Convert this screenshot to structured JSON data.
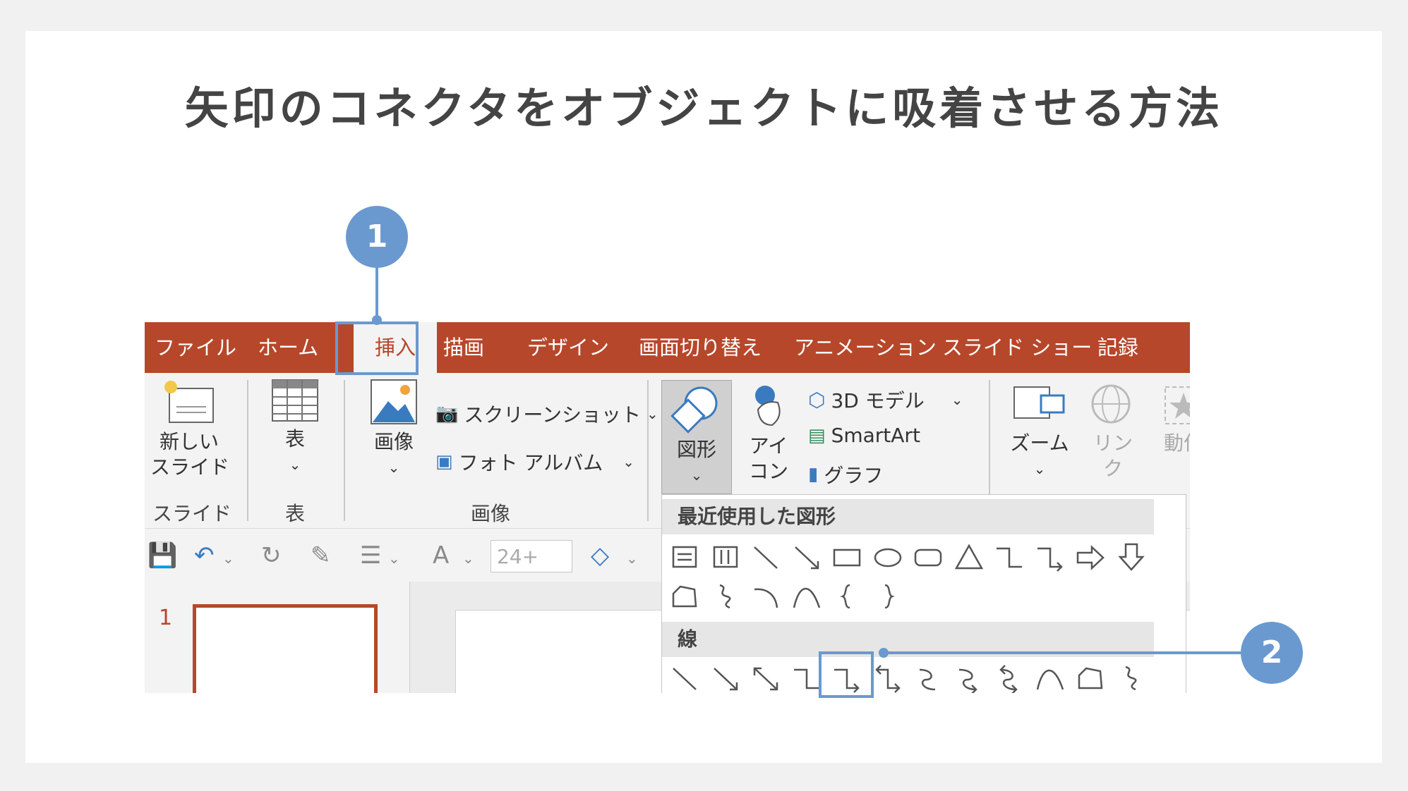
{
  "title": "矢印のコネクタをオブジェクトに吸着させる方法",
  "tabs": [
    "ファイル",
    "ホーム",
    "挿入",
    "描画",
    "デザイン",
    "画面切り替え",
    "アニメーション",
    "スライド ショー",
    "記録"
  ],
  "ribbon": {
    "new_slide": "新しい\nスライド",
    "table": "表",
    "image": "画像",
    "screenshot": "スクリーンショット",
    "photo_album": "フォト アルバム",
    "shapes": "図形",
    "icons": "アイ\nコン",
    "model_3d": "3D モデル",
    "smartart": "SmartArt",
    "chart": "グラフ",
    "zoom": "ズーム",
    "link": "リン\nク",
    "action": "動作",
    "groups": {
      "slides": "スライド",
      "table": "表",
      "images": "画像"
    }
  },
  "qat": {
    "font_size": "24+"
  },
  "slide_panel": {
    "number": "1"
  },
  "shapes_menu": {
    "recent_header": "最近使用した図形",
    "lines_header": "線"
  },
  "annotations": {
    "badge1": "1",
    "badge2": "2"
  },
  "colors": {
    "accent_tab": "#b7472a",
    "annotation": "#6a99d0"
  }
}
